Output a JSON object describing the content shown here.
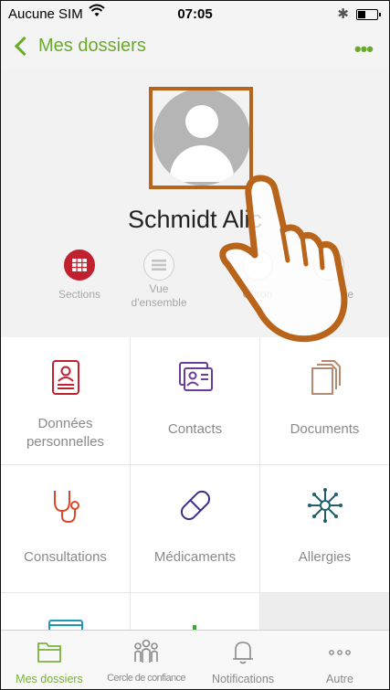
{
  "status": {
    "carrier": "Aucune SIM",
    "time": "07:05"
  },
  "nav": {
    "back_label": "Mes dossiers",
    "more_label": "•••"
  },
  "profile": {
    "name": "Schmidt Alic"
  },
  "view_tabs": [
    {
      "id": "sections",
      "label": "Sections",
      "active": true
    },
    {
      "id": "overview",
      "label": "Vue\nd'ensemble",
      "active": false
    },
    {
      "id": "chrono",
      "label": "Chron",
      "active": false
    },
    {
      "id": "other",
      "label": "e",
      "active": false
    }
  ],
  "sections": [
    {
      "id": "personal",
      "label": "Données personnelles",
      "icon": "id-card-icon",
      "color": "#c0202f"
    },
    {
      "id": "contacts",
      "label": "Contacts",
      "icon": "contact-card-icon",
      "color": "#6a3d9a"
    },
    {
      "id": "documents",
      "label": "Documents",
      "icon": "documents-icon",
      "color": "#b58a70"
    },
    {
      "id": "consultations",
      "label": "Consultations",
      "icon": "stethoscope-icon",
      "color": "#e0462a"
    },
    {
      "id": "medications",
      "label": "Médicaments",
      "icon": "pill-icon",
      "color": "#3a2f8c"
    },
    {
      "id": "allergies",
      "label": "Allergies",
      "icon": "allergen-icon",
      "color": "#1f5e6e"
    }
  ],
  "tabbar": [
    {
      "id": "folders",
      "label": "Mes dossiers",
      "icon": "folder-icon",
      "active": true
    },
    {
      "id": "trust",
      "label": "Cercle de confiance",
      "icon": "people-icon",
      "active": false
    },
    {
      "id": "notifications",
      "label": "Notifications",
      "icon": "bell-icon",
      "active": false
    },
    {
      "id": "other",
      "label": "Autre",
      "icon": "more-icon",
      "active": false
    }
  ],
  "colors": {
    "accent": "#6aaa2a",
    "active_section": "#c0202f",
    "focus": "#b8651b"
  }
}
